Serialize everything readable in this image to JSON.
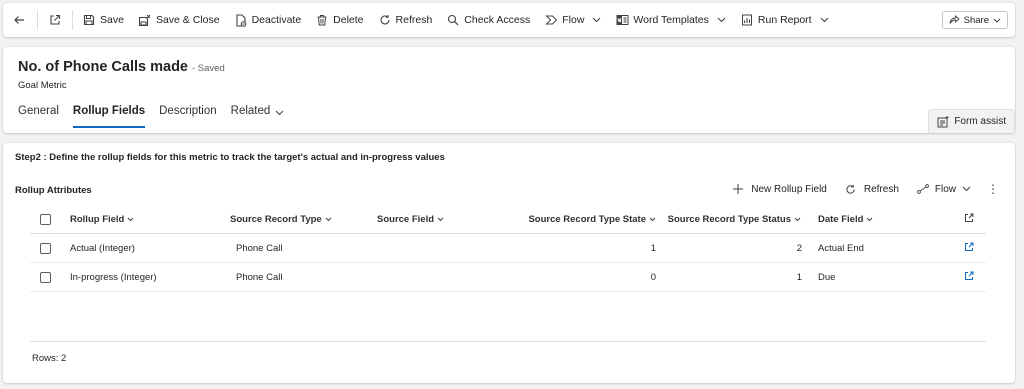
{
  "command_bar": {
    "back": "Back",
    "popout": "Open in new window",
    "save": "Save",
    "save_close": "Save & Close",
    "deactivate": "Deactivate",
    "delete": "Delete",
    "refresh": "Refresh",
    "check_access": "Check Access",
    "flow": "Flow",
    "word_templates": "Word Templates",
    "run_report": "Run Report",
    "share": "Share"
  },
  "record": {
    "title": "No. of Phone Calls made",
    "status": "- Saved",
    "entity": "Goal Metric"
  },
  "tabs": [
    {
      "label": "General"
    },
    {
      "label": "Rollup Fields"
    },
    {
      "label": "Description"
    },
    {
      "label": "Related"
    }
  ],
  "form_assist": "Form assist",
  "section": {
    "step_text": "Step2 : Define the rollup fields for this metric to track the target's actual and in-progress values"
  },
  "subgrid": {
    "title": "Rollup Attributes",
    "new_label": "New Rollup Field",
    "refresh_label": "Refresh",
    "flow_label": "Flow",
    "more_label": "⋮",
    "columns": {
      "rollup_field": "Rollup Field",
      "source_record_type": "Source Record Type",
      "source_field": "Source Field",
      "state": "Source Record Type State",
      "status": "Source Record Type Status",
      "date_field": "Date Field"
    },
    "rows": [
      {
        "rollup_field": "Actual (Integer)",
        "source_record_type": "Phone Call",
        "source_field": "",
        "state": "1",
        "status": "2",
        "date_field": "Actual End"
      },
      {
        "rollup_field": "In-progress (Integer)",
        "source_record_type": "Phone Call",
        "source_field": "",
        "state": "0",
        "status": "1",
        "date_field": "Due"
      }
    ],
    "rows_count": "Rows: 2"
  },
  "colors": {
    "accent": "#0f6cbd",
    "text": "#242424",
    "background": "#f3f2f1"
  }
}
